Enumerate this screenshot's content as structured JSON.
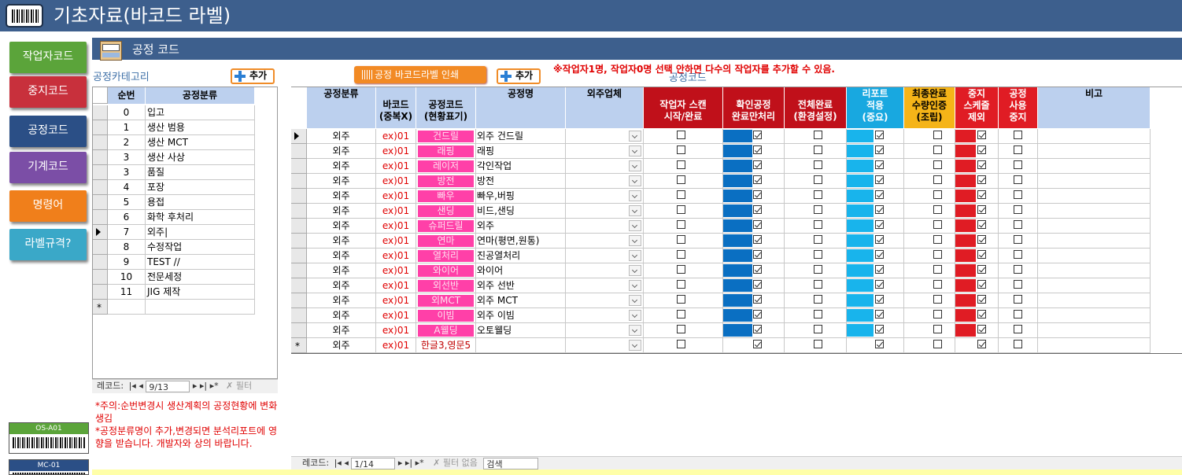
{
  "app": {
    "title": "기초자료(바코드 라벨)"
  },
  "nav": {
    "items": [
      {
        "label": "작업자코드",
        "color": "#5ba43a"
      },
      {
        "label": "중지코드",
        "color": "#c8303c"
      },
      {
        "label": "공정코드",
        "color": "#2b4f86"
      },
      {
        "label": "기계코드",
        "color": "#7b4ea6"
      },
      {
        "label": "명령어",
        "color": "#f07f1b"
      },
      {
        "label": "라벨규격?",
        "color": "#3aa8c8"
      }
    ]
  },
  "barcode_labels": [
    "OS-A01",
    "MC-01"
  ],
  "section": {
    "title": "공정 코드"
  },
  "category": {
    "label": "공정카테고리",
    "add_label": "추가",
    "headers": [
      "순번",
      "공정분류"
    ],
    "rows": [
      [
        "0",
        "입고"
      ],
      [
        "1",
        "생산 범용"
      ],
      [
        "2",
        "생산 MCT"
      ],
      [
        "3",
        "생산 사상"
      ],
      [
        "3",
        "품질"
      ],
      [
        "4",
        "포장"
      ],
      [
        "5",
        "용접"
      ],
      [
        "6",
        "화학 후처리"
      ],
      [
        "7",
        "외주|"
      ],
      [
        "8",
        "수정작업"
      ],
      [
        "9",
        "TEST //"
      ],
      [
        "10",
        "전문세정"
      ],
      [
        "11",
        "JIG 제작"
      ]
    ],
    "current_row": 8,
    "nav_label": "레코드:",
    "nav_pos": "9/13",
    "filter_label": "필터"
  },
  "notes": [
    "*주의:순번변경시 생산계획의 공정현황에 변화생김",
    "*공정분류명이 추가,변경되면 분석리포트에 영향을 받습니다. 개발자와 상의 바랍니다."
  ],
  "process": {
    "label": "공정코드",
    "print_label": "공정 바코드라벨 인쇄",
    "add_label": "추가",
    "warning": "※작업자1명, 작업자0명 선택 안하면 다수의 작업자를 추가할 수 있음.",
    "headers": {
      "category": "공정분류",
      "barcode": "바코드\n(중복X)",
      "code": "공정코드\n(현황표기)",
      "name": "공정명",
      "vendor": "외주업체",
      "scan": "작업자 스캔\n시작/완료",
      "confirm": "확인공정\n완료만처리",
      "all_done": "전체완료\n(환경설정)",
      "report": "리포트\n적용\n(중요)",
      "final": "최종완료\n수량인증\n(조립)",
      "stop": "중지\n스케줄\n제외",
      "unused": "공정\n사용\n중지",
      "memo": "비고"
    },
    "header_colors": {
      "scan": "#c0101a",
      "confirm": "#c0101a",
      "all_done": "#c0101a",
      "report": "#18a8e0",
      "final": "#f5b418",
      "stop": "#e01c24",
      "unused": "#e01c24",
      "default": "#bcd0ee"
    },
    "rows": [
      {
        "category": "외주",
        "barcode": "ex)01",
        "code": "건드릴",
        "name": "외주 건드릴"
      },
      {
        "category": "외주",
        "barcode": "ex)01",
        "code": "래핑",
        "name": "래핑"
      },
      {
        "category": "외주",
        "barcode": "ex)01",
        "code": "레이저",
        "name": "각인작업"
      },
      {
        "category": "외주",
        "barcode": "ex)01",
        "code": "방전",
        "name": "방전"
      },
      {
        "category": "외주",
        "barcode": "ex)01",
        "code": "빠우",
        "name": "빠우,버핑"
      },
      {
        "category": "외주",
        "barcode": "ex)01",
        "code": "샌딩",
        "name": "비드,샌딩"
      },
      {
        "category": "외주",
        "barcode": "ex)01",
        "code": "슈퍼드릴",
        "name": "외주"
      },
      {
        "category": "외주",
        "barcode": "ex)01",
        "code": "연마",
        "name": "연마(평면,원통)"
      },
      {
        "category": "외주",
        "barcode": "ex)01",
        "code": "열처리",
        "name": "진공열처리"
      },
      {
        "category": "외주",
        "barcode": "ex)01",
        "code": "와이어",
        "name": "와이어"
      },
      {
        "category": "외주",
        "barcode": "ex)01",
        "code": "외선반",
        "name": "외주 선반"
      },
      {
        "category": "외주",
        "barcode": "ex)01",
        "code": "외MCT",
        "name": "외주 MCT"
      },
      {
        "category": "외주",
        "barcode": "ex)01",
        "code": "이빔",
        "name": "외주 이빔"
      },
      {
        "category": "외주",
        "barcode": "ex)01",
        "code": "A웰딩",
        "name": "오토웰딩"
      }
    ],
    "new_row": {
      "category": "외주",
      "barcode": "ex)01",
      "code": "한글3,영문5"
    },
    "nav_label": "레코드:",
    "nav_pos": "1/14",
    "filter_label": "필터 없음",
    "search_label": "검색"
  }
}
